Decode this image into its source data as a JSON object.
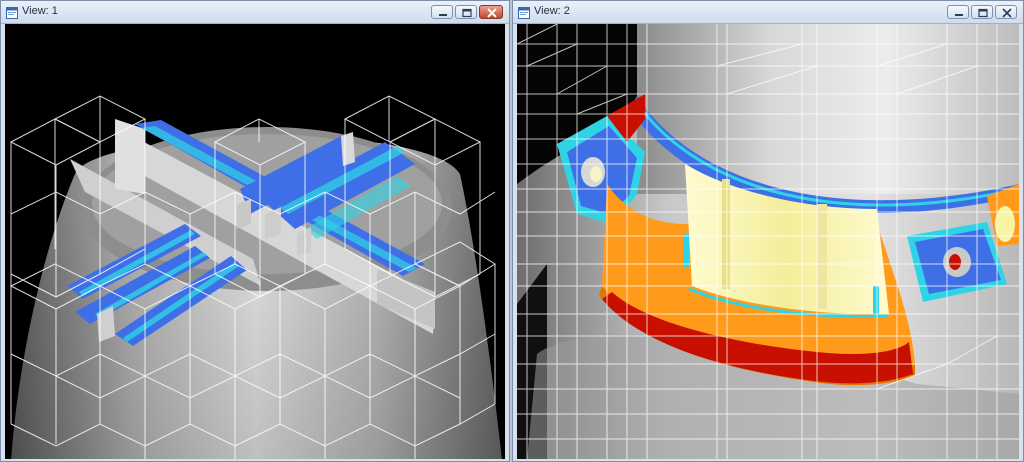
{
  "view1": {
    "title": "View: 1",
    "icon": "view-window-icon",
    "controls": [
      "minimize-icon",
      "maximize-icon",
      "close-icon"
    ]
  },
  "view2": {
    "title": "View: 2",
    "icon": "view-window-icon",
    "controls": [
      "minimize-icon",
      "maximize-icon",
      "close-icon"
    ]
  },
  "colors": {
    "viewport1_background": "#000000",
    "mesh_blue": "#3f6fe6",
    "mesh_cyan": "#2fd3e6",
    "mesh_orange": "#ff9a1a",
    "mesh_red": "#c81000",
    "mesh_yellow": "#f8f4a4",
    "grid_lines": "#ffffff"
  }
}
